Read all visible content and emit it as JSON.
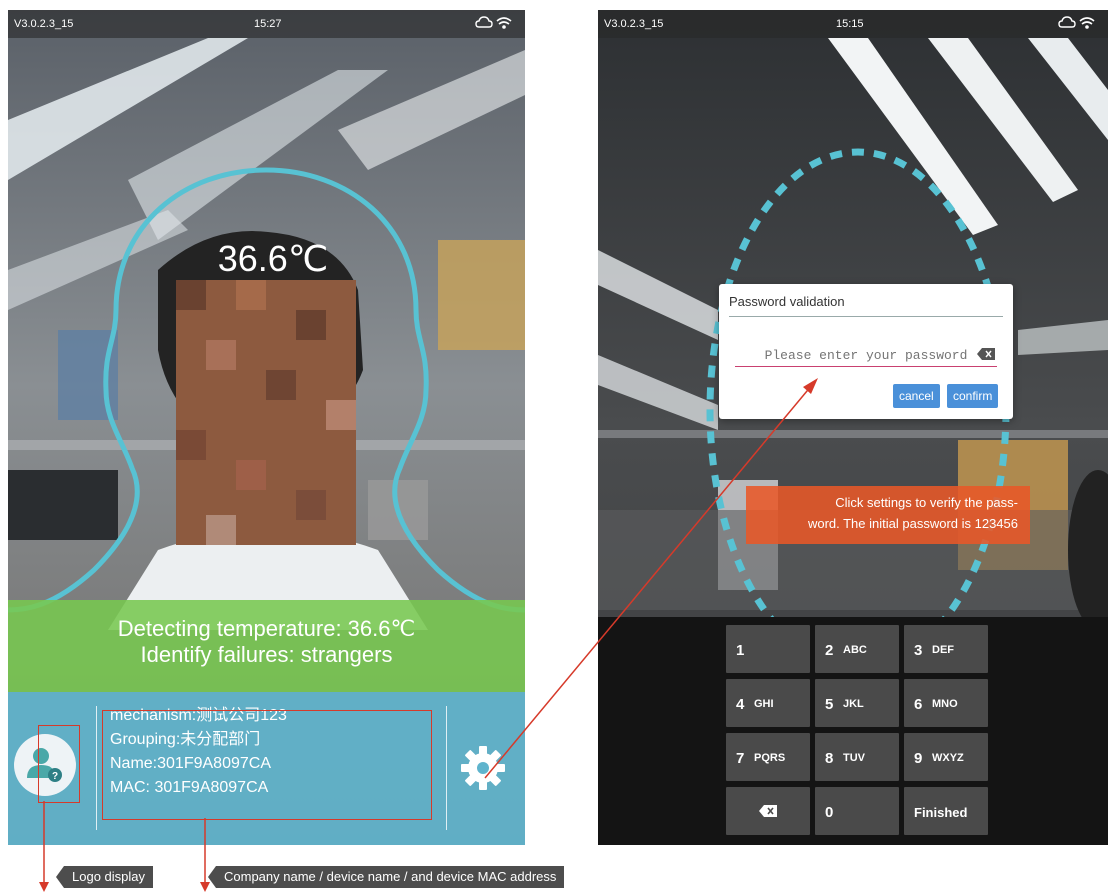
{
  "left_screen": {
    "status": {
      "version": "V3.0.2.3_15",
      "time": "15:27"
    },
    "temperature_readout": "36.6℃",
    "status_band": {
      "line1": "Detecting temperature: 36.6℃",
      "line2": "Identify failures: strangers"
    },
    "device_info": {
      "mechanism": "mechanism:测试公司123",
      "grouping": "Grouping:未分配部门",
      "name": "Name:301F9A8097CA",
      "mac": "MAC: 301F9A8097CA"
    }
  },
  "right_screen": {
    "status": {
      "version": "V3.0.2.3_15",
      "time": "15:15"
    },
    "dialog": {
      "title": "Password validation",
      "placeholder": "Please enter your password",
      "cancel_label": "cancel",
      "confirm_label": "confirm"
    },
    "note": {
      "line1": "Click settings to verify the pass-",
      "line2": "word. The initial password is 123456"
    },
    "keypad": [
      {
        "num": "1",
        "letters": ""
      },
      {
        "num": "2",
        "letters": "ABC"
      },
      {
        "num": "3",
        "letters": "DEF"
      },
      {
        "num": "4",
        "letters": "GHI"
      },
      {
        "num": "5",
        "letters": "JKL"
      },
      {
        "num": "6",
        "letters": "MNO"
      },
      {
        "num": "7",
        "letters": "PQRS"
      },
      {
        "num": "8",
        "letters": "TUV"
      },
      {
        "num": "9",
        "letters": "WXYZ"
      },
      {
        "num": "",
        "letters": "",
        "icon": "backspace-icon"
      },
      {
        "num": "0",
        "letters": ""
      },
      {
        "num": "Finished",
        "letters": ""
      }
    ]
  },
  "callouts": {
    "logo": "Logo display",
    "company": "Company name / device name / and device MAC address"
  },
  "colors": {
    "accent_teal": "#5fb4cd",
    "status_green": "#78c850",
    "annotation_red": "#d63a2a",
    "note_orange": "#e85828",
    "button_blue": "#4a90d9"
  }
}
